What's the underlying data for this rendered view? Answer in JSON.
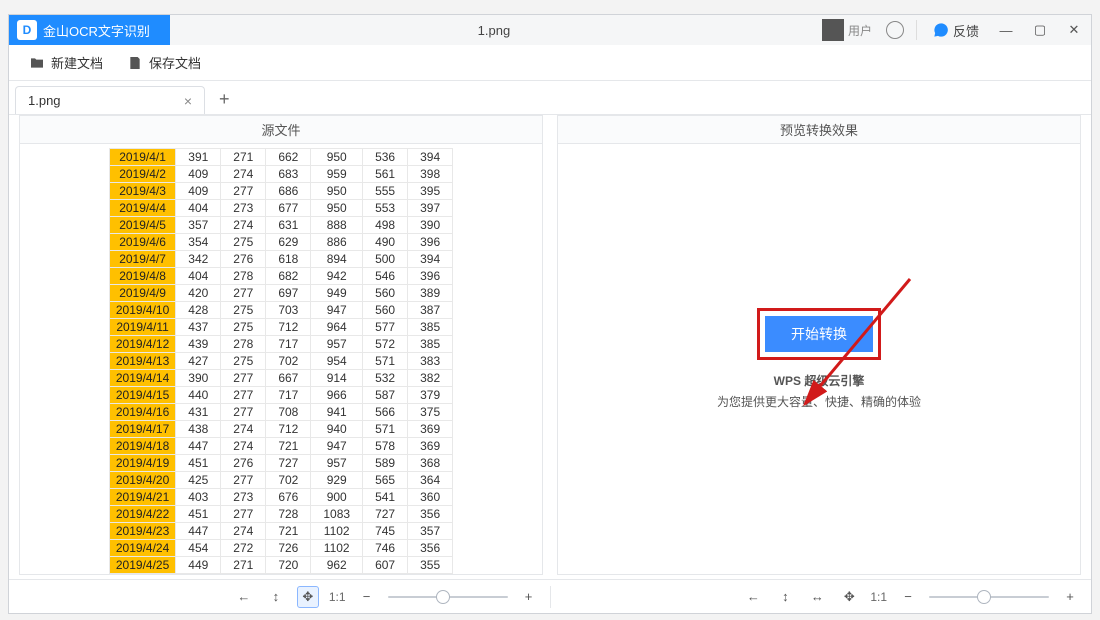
{
  "titlebar": {
    "app_name": "金山OCR文字识别",
    "document_name": "1.png",
    "user_name": "用户",
    "feedback_label": "反馈"
  },
  "toolbar": {
    "new_doc": "新建文档",
    "save_doc": "保存文档"
  },
  "tab": {
    "name": "1.png",
    "close": "×",
    "add": "+"
  },
  "panels": {
    "source_title": "源文件",
    "preview_title": "预览转换效果"
  },
  "cta": {
    "start_label": "开始转换",
    "promo_line1": "WPS 超级云引擎",
    "promo_line2": "为您提供更大容量、快捷、精确的体验"
  },
  "bottombar": {
    "scale_label": "1:1",
    "minus": "−",
    "plus": "+"
  },
  "icons": {
    "folder": "folder-icon",
    "save": "save-icon",
    "hand": "hand-icon",
    "move": "move-icon",
    "fit_h": "fit-h-icon",
    "fit_w": "fit-w-icon",
    "fit_both": "fit-both-icon"
  },
  "colors": {
    "accent": "#1f8cff",
    "highlight_cell": "#ffc000",
    "annotation_red": "#d11a1a"
  },
  "table": {
    "rows": [
      {
        "date": "2019/4/1",
        "c1": "391",
        "c2": "271",
        "c3": "662",
        "c4": "950",
        "c5": "536",
        "c6": "394"
      },
      {
        "date": "2019/4/2",
        "c1": "409",
        "c2": "274",
        "c3": "683",
        "c4": "959",
        "c5": "561",
        "c6": "398"
      },
      {
        "date": "2019/4/3",
        "c1": "409",
        "c2": "277",
        "c3": "686",
        "c4": "950",
        "c5": "555",
        "c6": "395"
      },
      {
        "date": "2019/4/4",
        "c1": "404",
        "c2": "273",
        "c3": "677",
        "c4": "950",
        "c5": "553",
        "c6": "397"
      },
      {
        "date": "2019/4/5",
        "c1": "357",
        "c2": "274",
        "c3": "631",
        "c4": "888",
        "c5": "498",
        "c6": "390"
      },
      {
        "date": "2019/4/6",
        "c1": "354",
        "c2": "275",
        "c3": "629",
        "c4": "886",
        "c5": "490",
        "c6": "396"
      },
      {
        "date": "2019/4/7",
        "c1": "342",
        "c2": "276",
        "c3": "618",
        "c4": "894",
        "c5": "500",
        "c6": "394"
      },
      {
        "date": "2019/4/8",
        "c1": "404",
        "c2": "278",
        "c3": "682",
        "c4": "942",
        "c5": "546",
        "c6": "396"
      },
      {
        "date": "2019/4/9",
        "c1": "420",
        "c2": "277",
        "c3": "697",
        "c4": "949",
        "c5": "560",
        "c6": "389"
      },
      {
        "date": "2019/4/10",
        "c1": "428",
        "c2": "275",
        "c3": "703",
        "c4": "947",
        "c5": "560",
        "c6": "387"
      },
      {
        "date": "2019/4/11",
        "c1": "437",
        "c2": "275",
        "c3": "712",
        "c4": "964",
        "c5": "577",
        "c6": "385"
      },
      {
        "date": "2019/4/12",
        "c1": "439",
        "c2": "278",
        "c3": "717",
        "c4": "957",
        "c5": "572",
        "c6": "385"
      },
      {
        "date": "2019/4/13",
        "c1": "427",
        "c2": "275",
        "c3": "702",
        "c4": "954",
        "c5": "571",
        "c6": "383"
      },
      {
        "date": "2019/4/14",
        "c1": "390",
        "c2": "277",
        "c3": "667",
        "c4": "914",
        "c5": "532",
        "c6": "382"
      },
      {
        "date": "2019/4/15",
        "c1": "440",
        "c2": "277",
        "c3": "717",
        "c4": "966",
        "c5": "587",
        "c6": "379"
      },
      {
        "date": "2019/4/16",
        "c1": "431",
        "c2": "277",
        "c3": "708",
        "c4": "941",
        "c5": "566",
        "c6": "375"
      },
      {
        "date": "2019/4/17",
        "c1": "438",
        "c2": "274",
        "c3": "712",
        "c4": "940",
        "c5": "571",
        "c6": "369"
      },
      {
        "date": "2019/4/18",
        "c1": "447",
        "c2": "274",
        "c3": "721",
        "c4": "947",
        "c5": "578",
        "c6": "369"
      },
      {
        "date": "2019/4/19",
        "c1": "451",
        "c2": "276",
        "c3": "727",
        "c4": "957",
        "c5": "589",
        "c6": "368"
      },
      {
        "date": "2019/4/20",
        "c1": "425",
        "c2": "277",
        "c3": "702",
        "c4": "929",
        "c5": "565",
        "c6": "364"
      },
      {
        "date": "2019/4/21",
        "c1": "403",
        "c2": "273",
        "c3": "676",
        "c4": "900",
        "c5": "541",
        "c6": "360"
      },
      {
        "date": "2019/4/22",
        "c1": "451",
        "c2": "277",
        "c3": "728",
        "c4": "1083",
        "c5": "727",
        "c6": "356"
      },
      {
        "date": "2019/4/23",
        "c1": "447",
        "c2": "274",
        "c3": "721",
        "c4": "1102",
        "c5": "745",
        "c6": "357"
      },
      {
        "date": "2019/4/24",
        "c1": "454",
        "c2": "272",
        "c3": "726",
        "c4": "1102",
        "c5": "746",
        "c6": "356"
      },
      {
        "date": "2019/4/25",
        "c1": "449",
        "c2": "271",
        "c3": "720",
        "c4": "962",
        "c5": "607",
        "c6": "355"
      }
    ]
  }
}
